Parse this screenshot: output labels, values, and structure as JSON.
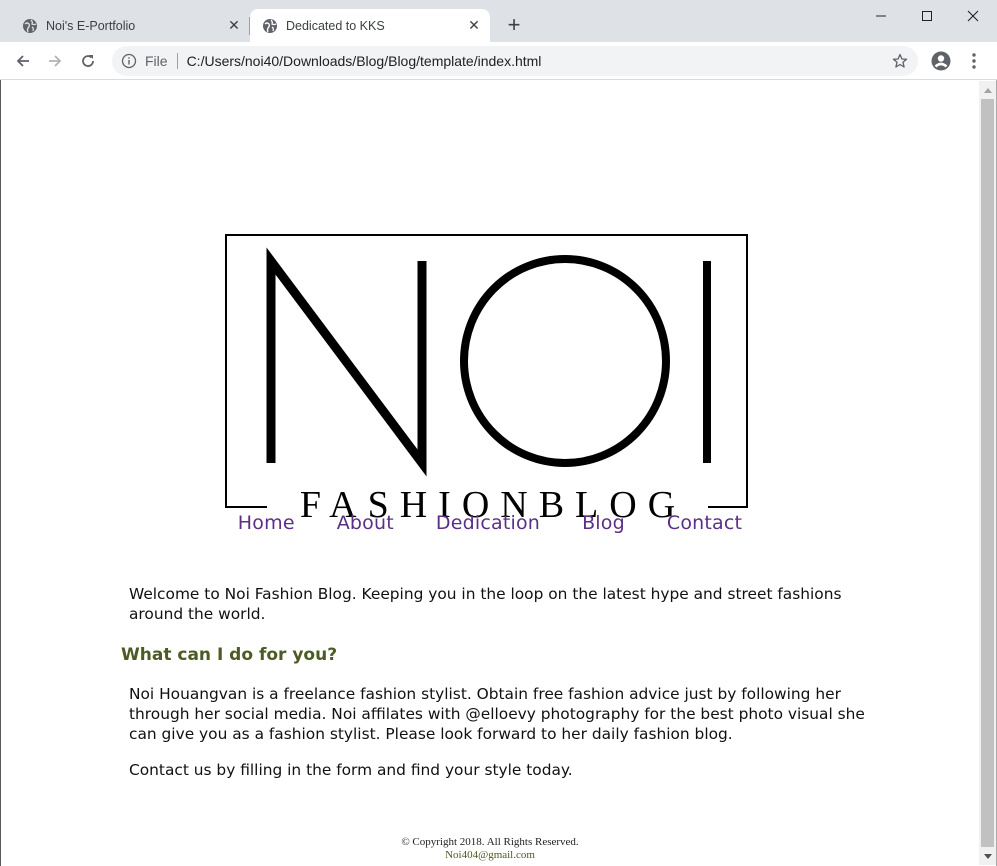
{
  "browser": {
    "tabs": [
      {
        "title": "Noi's E-Portfolio",
        "active": false
      },
      {
        "title": "Dedicated to KKS",
        "active": true
      }
    ],
    "address": {
      "scheme_label": "File",
      "url": "C:/Users/noi40/Downloads/Blog/Blog/template/index.html"
    }
  },
  "logo": {
    "text": "NOI",
    "wordmark": "FASHIONBLOG"
  },
  "nav": {
    "items": [
      "Home",
      "About",
      "Dedication",
      "Blog",
      "Contact"
    ]
  },
  "content": {
    "welcome": "Welcome to Noi Fashion Blog. Keeping you in the loop on the latest hype and street fashions around the world.",
    "heading": "What can I do for you?",
    "paragraph": "Noi Houangvan is a freelance fashion stylist. Obtain free fashion advice just by following her through her social media. Noi affilates with @elloevy photography for the best photo visual she can give you as a fashion stylist. Please look forward to her daily fashion blog.",
    "contact": "Contact us by filling in the form and find your style today."
  },
  "footer": {
    "copyright": "© Copyright 2018. All Rights Reserved.",
    "email": "Noi404@gmail.com"
  },
  "colors": {
    "nav_link": "#5c2f86",
    "heading": "#4b5b23",
    "tabstrip": "#dee1e6"
  }
}
